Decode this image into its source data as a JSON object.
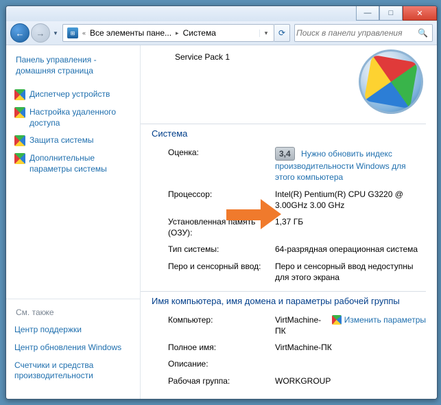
{
  "title_controls": {
    "min": "—",
    "max": "□",
    "close": "✕"
  },
  "nav": {
    "back": "←",
    "forward": "→",
    "refresh": "⟳",
    "search_icon": "🔍"
  },
  "breadcrumb": {
    "seg1": "Все элементы пане...",
    "seg2": "Система"
  },
  "search": {
    "placeholder": "Поиск в панели управления"
  },
  "sidebar": {
    "home": "Панель управления - домашняя страница",
    "items": [
      {
        "label": "Диспетчер устройств"
      },
      {
        "label": "Настройка удаленного доступа"
      },
      {
        "label": "Защита системы"
      },
      {
        "label": "Дополнительные параметры системы"
      }
    ],
    "see_also_head": "См. также",
    "see_also": [
      {
        "label": "Центр поддержки"
      },
      {
        "label": "Центр обновления Windows"
      },
      {
        "label": "Счетчики и средства производительности"
      }
    ]
  },
  "content": {
    "service_pack": "Service Pack 1",
    "section_system": "Система",
    "rows": {
      "rating_label": "Оценка:",
      "rating_score": "3,4",
      "rating_link": "Нужно обновить индекс производительности Windows для этого компьютера",
      "cpu_label": "Процессор:",
      "cpu_value": "Intel(R) Pentium(R) CPU G3220 @ 3.00GHz   3.00 GHz",
      "ram_label": "Установленная память (ОЗУ):",
      "ram_value": "1,37 ГБ",
      "systype_label": "Тип системы:",
      "systype_value": "64-разрядная операционная система",
      "pen_label": "Перо и сенсорный ввод:",
      "pen_value": "Перо и сенсорный ввод недоступны для этого экрана"
    },
    "section_domain": "Имя компьютера, имя домена и параметры рабочей группы",
    "domain_rows": {
      "comp_label": "Компьютер:",
      "comp_value": "VirtMachine-ПК",
      "change_link": "Изменить параметры",
      "full_label": "Полное имя:",
      "full_value": "VirtMachine-ПК",
      "desc_label": "Описание:",
      "desc_value": "",
      "wg_label": "Рабочая группа:",
      "wg_value": "WORKGROUP"
    }
  }
}
